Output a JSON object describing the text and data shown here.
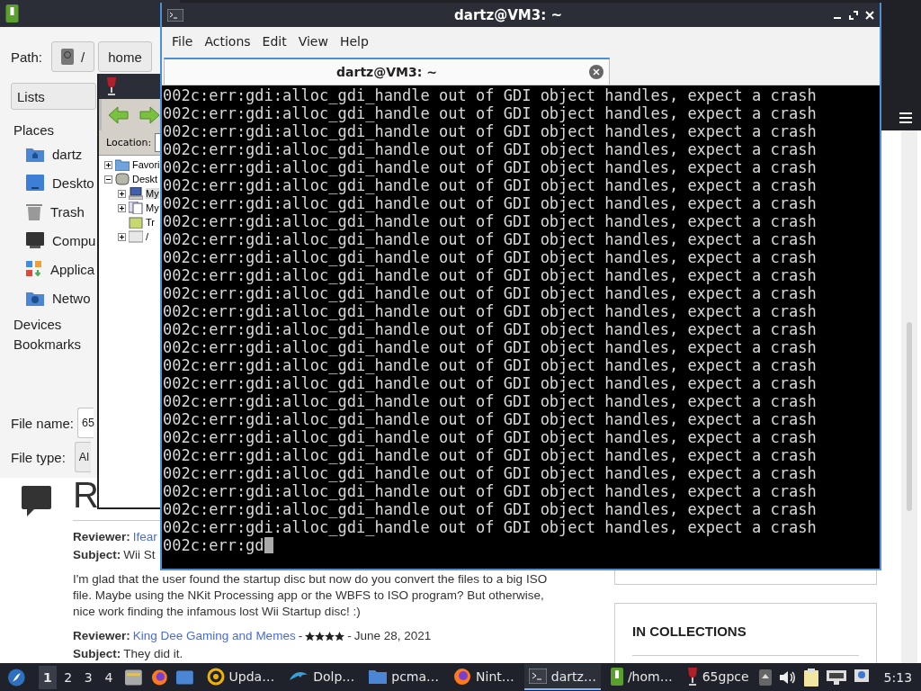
{
  "browser": {
    "heading": "R",
    "reviews": [
      {
        "reviewer_label": "Reviewer:",
        "reviewer": "Ifear",
        "subject_label": "Subject:",
        "subject": "Wii St",
        "body": "I'm glad that the user found the startup disc but now do you convert the files to a big ISO file. Maybe using the NKit Processing app or the WBFS to ISO program? But otherwise, nice work finding the infamous lost Wii Startup disc! :)"
      },
      {
        "reviewer_label": "Reviewer:",
        "reviewer": "King Dee Gaming and Memes",
        "separator_1": "-",
        "stars": 4,
        "separator_2": "-",
        "date": "June 28, 2021",
        "subject_label": "Subject:",
        "subject": "They did it."
      }
    ],
    "collections_title": "IN COLLECTIONS"
  },
  "file_dialog": {
    "path_label": "Path:",
    "path_buttons": [
      {
        "label": "/",
        "kind": "root"
      },
      {
        "label": "home",
        "kind": "dir"
      }
    ],
    "view_select": "Lists",
    "places_title": "Places",
    "places": [
      {
        "label": "dartz",
        "kind": "home"
      },
      {
        "label": "Deskto",
        "kind": "desktop"
      },
      {
        "label": "Trash",
        "kind": "trash"
      },
      {
        "label": "Compu",
        "kind": "computer"
      },
      {
        "label": "Applica",
        "kind": "apps"
      },
      {
        "label": "Netwo",
        "kind": "network"
      }
    ],
    "sections": [
      "Devices",
      "Bookmarks"
    ],
    "file_name_label": "File name:",
    "file_name": "65",
    "file_type_label": "File type:",
    "file_type": "Al"
  },
  "wine_explorer": {
    "location_label": "Location:",
    "tree": [
      {
        "label": "Favori",
        "kind": "folder",
        "expanded": false,
        "selected": false
      },
      {
        "label": "Deskt",
        "kind": "desktop",
        "expanded": true,
        "selected": false,
        "children": [
          {
            "label": "My",
            "kind": "computer",
            "expanded": false,
            "selected": true
          },
          {
            "label": "My",
            "kind": "documents",
            "expanded": false,
            "selected": false
          },
          {
            "label": "Tr",
            "kind": "trash",
            "selected": false
          },
          {
            "label": "/",
            "kind": "drive",
            "expanded": false,
            "selected": false
          }
        ]
      }
    ]
  },
  "terminal": {
    "title": "dartz@VM3: ~",
    "menu": [
      "File",
      "Actions",
      "Edit",
      "View",
      "Help"
    ],
    "tabs": [
      {
        "label": "dartz@VM3: ~",
        "selected": true
      }
    ],
    "lines": [
      "002c:err:gdi:alloc_gdi_handle out of GDI object handles, expect a crash",
      "002c:err:gdi:alloc_gdi_handle out of GDI object handles, expect a crash",
      "002c:err:gdi:alloc_gdi_handle out of GDI object handles, expect a crash",
      "002c:err:gdi:alloc_gdi_handle out of GDI object handles, expect a crash",
      "002c:err:gdi:alloc_gdi_handle out of GDI object handles, expect a crash",
      "002c:err:gdi:alloc_gdi_handle out of GDI object handles, expect a crash",
      "002c:err:gdi:alloc_gdi_handle out of GDI object handles, expect a crash",
      "002c:err:gdi:alloc_gdi_handle out of GDI object handles, expect a crash",
      "002c:err:gdi:alloc_gdi_handle out of GDI object handles, expect a crash",
      "002c:err:gdi:alloc_gdi_handle out of GDI object handles, expect a crash",
      "002c:err:gdi:alloc_gdi_handle out of GDI object handles, expect a crash",
      "002c:err:gdi:alloc_gdi_handle out of GDI object handles, expect a crash",
      "002c:err:gdi:alloc_gdi_handle out of GDI object handles, expect a crash",
      "002c:err:gdi:alloc_gdi_handle out of GDI object handles, expect a crash",
      "002c:err:gdi:alloc_gdi_handle out of GDI object handles, expect a crash",
      "002c:err:gdi:alloc_gdi_handle out of GDI object handles, expect a crash",
      "002c:err:gdi:alloc_gdi_handle out of GDI object handles, expect a crash",
      "002c:err:gdi:alloc_gdi_handle out of GDI object handles, expect a crash",
      "002c:err:gdi:alloc_gdi_handle out of GDI object handles, expect a crash",
      "002c:err:gdi:alloc_gdi_handle out of GDI object handles, expect a crash",
      "002c:err:gdi:alloc_gdi_handle out of GDI object handles, expect a crash",
      "002c:err:gdi:alloc_gdi_handle out of GDI object handles, expect a crash",
      "002c:err:gdi:alloc_gdi_handle out of GDI object handles, expect a crash",
      "002c:err:gdi:alloc_gdi_handle out of GDI object handles, expect a crash",
      "002c:err:gdi:alloc_gdi_handle out of GDI object handles, expect a crash"
    ],
    "input_line": "002c:err:gd"
  },
  "taskbar": {
    "workspaces": [
      {
        "label": "1",
        "selected": true
      },
      {
        "label": "2",
        "selected": false
      },
      {
        "label": "3",
        "selected": false
      },
      {
        "label": "4",
        "selected": false
      }
    ],
    "tasks": [
      {
        "label": "Upda…",
        "kind": "update",
        "selected": false
      },
      {
        "label": "Dolp…",
        "kind": "dolphin",
        "selected": false
      },
      {
        "label": "pcma…",
        "kind": "folder",
        "selected": false
      },
      {
        "label": "Nint…",
        "kind": "firefox",
        "selected": false
      },
      {
        "label": "dartz…",
        "kind": "terminal",
        "selected": true
      },
      {
        "label": "/hom…",
        "kind": "archive",
        "selected": false
      },
      {
        "label": "65gpce",
        "kind": "wine",
        "selected": false
      }
    ],
    "clock": "5:13"
  }
}
